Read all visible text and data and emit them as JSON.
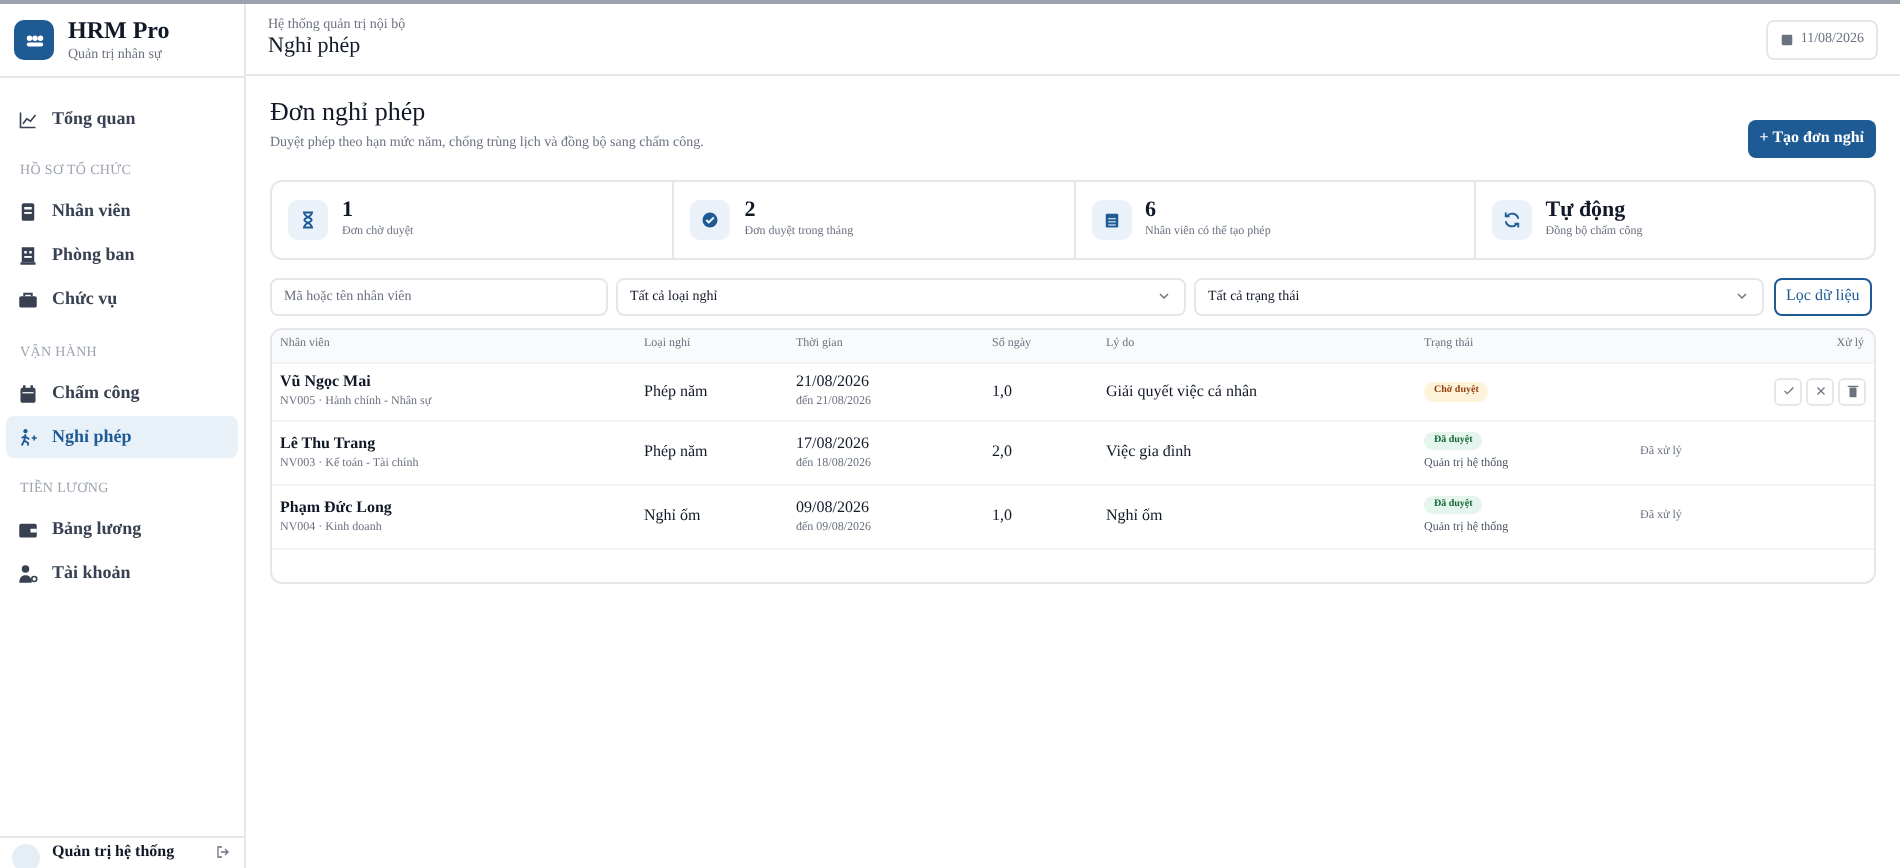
{
  "brand": {
    "name": "HRM Pro",
    "subtitle": "Quản trị nhân sự"
  },
  "sidebar": {
    "items": [
      {
        "kind": "link",
        "label": "Tổng quan",
        "selected": false
      },
      {
        "kind": "section",
        "label": "HỒ SƠ TỔ CHỨC"
      },
      {
        "kind": "link",
        "label": "Nhân viên",
        "selected": false
      },
      {
        "kind": "link",
        "label": "Phòng ban",
        "selected": false
      },
      {
        "kind": "link",
        "label": "Chức vụ",
        "selected": false
      },
      {
        "kind": "section",
        "label": "VẬN HÀNH"
      },
      {
        "kind": "link",
        "label": "Chấm công",
        "selected": false
      },
      {
        "kind": "link",
        "label": "Nghỉ phép",
        "selected": true
      },
      {
        "kind": "section",
        "label": "TIỀN LƯƠNG"
      },
      {
        "kind": "link",
        "label": "Bảng lương",
        "selected": false
      },
      {
        "kind": "link",
        "label": "Tài khoản",
        "selected": false
      }
    ],
    "user": {
      "name": "Quản trị hệ thống"
    }
  },
  "header": {
    "breadcrumb": "Hệ thống quản trị nội bộ",
    "title": "Nghỉ phép",
    "date": "11/08/2026"
  },
  "page": {
    "title": "Đơn nghỉ phép",
    "subtitle": "Duyệt phép theo hạn mức năm, chống trùng lịch và đồng bộ sang chấm công.",
    "create_button": "+ Tạo đơn nghỉ"
  },
  "stats": [
    {
      "value": "1",
      "label": "Đơn chờ duyệt"
    },
    {
      "value": "2",
      "label": "Đơn duyệt trong tháng"
    },
    {
      "value": "6",
      "label": "Nhân viên có thể tạo phép"
    },
    {
      "value": "Tự động",
      "label": "Đồng bộ chấm công"
    }
  ],
  "filters": {
    "search": {
      "placeholder": "Mã hoặc tên nhân viên"
    },
    "type_select": "Tất cả loại nghỉ",
    "status_select": "Tất cả trạng thái",
    "filter_button": "Lọc dữ liệu"
  },
  "table": {
    "columns": [
      "Nhân viên",
      "Loại nghỉ",
      "Thời gian",
      "Số ngày",
      "Lý do",
      "Trạng thái",
      "Xử lý"
    ],
    "rows": [
      {
        "name": "Vũ Ngọc Mai",
        "meta": "NV005 · Hành chính - Nhân sự",
        "type": "Phép năm",
        "start": "21/08/2026",
        "end": "đến 21/08/2026",
        "days": "1,0",
        "reason": "Giải quyết việc cá nhân",
        "status": {
          "kind": "pending",
          "label": "Chờ duyệt"
        },
        "actions": [
          {
            "kind": "approve"
          },
          {
            "kind": "reject"
          },
          {
            "kind": "delete"
          }
        ]
      },
      {
        "name": "Lê Thu Trang",
        "meta": "NV003 · Kế toán - Tài chính",
        "type": "Phép năm",
        "start": "17/08/2026",
        "end": "đến 18/08/2026",
        "days": "2,0",
        "reason": "Việc gia đình",
        "status": {
          "kind": "approved",
          "label": "Đã duyệt",
          "by": "Quản trị hệ thống"
        },
        "handled": "Đã xử lý"
      },
      {
        "name": "Phạm Đức Long",
        "meta": "NV004 · Kinh doanh",
        "type": "Nghỉ ốm",
        "start": "09/08/2026",
        "end": "đến 09/08/2026",
        "days": "1,0",
        "reason": "Nghỉ ốm",
        "status": {
          "kind": "approved",
          "label": "Đã duyệt",
          "by": "Quản trị hệ thống"
        },
        "handled": "Đã xử lý"
      }
    ]
  }
}
